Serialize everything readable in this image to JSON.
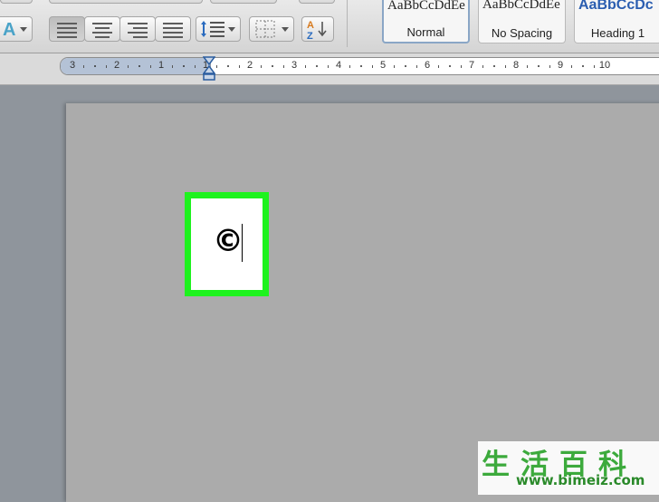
{
  "styles": {
    "items": [
      {
        "preview": "AaBbCcDdEe",
        "label": "Normal"
      },
      {
        "preview": "AaBbCcDdEe",
        "label": "No Spacing"
      },
      {
        "preview": "AaBbCcDc",
        "label": "Heading 1"
      }
    ]
  },
  "ruler": {
    "numbers": [
      "3",
      "2",
      "1",
      "1",
      "2",
      "3",
      "4",
      "5",
      "6",
      "7",
      "8",
      "9",
      "10"
    ]
  },
  "document": {
    "symbol": "©"
  },
  "watermark": {
    "chinese": "生活百科",
    "url": "www.bimeiz.com"
  },
  "colors": {
    "highlight": "#1ef21e",
    "heading_style": "#2a5db0"
  }
}
